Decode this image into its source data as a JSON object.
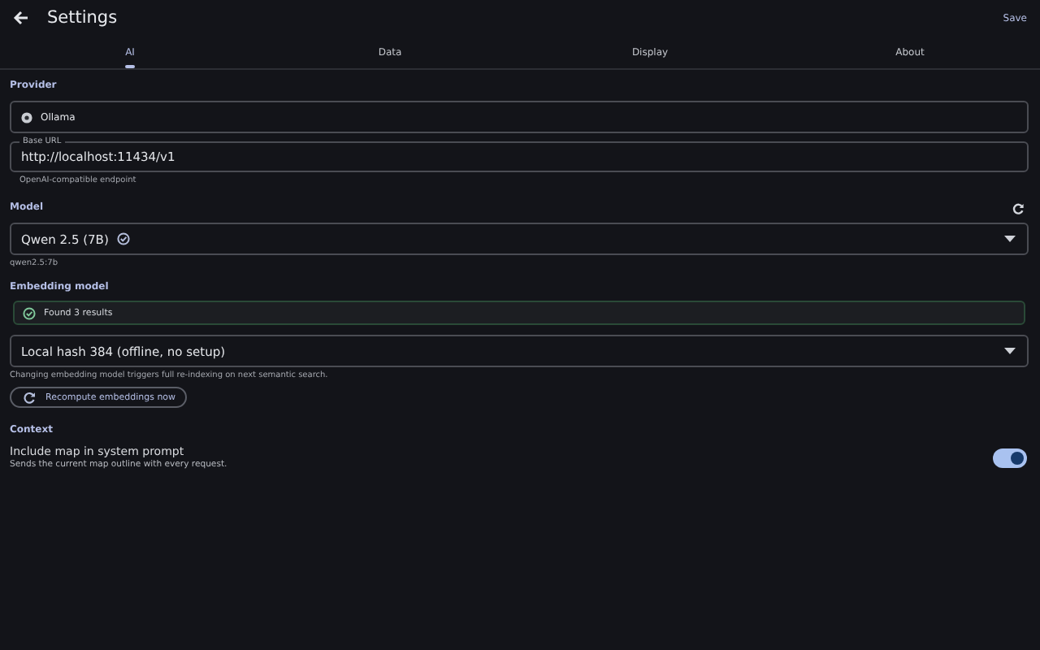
{
  "header": {
    "title": "Settings",
    "save": "Save"
  },
  "tabs": [
    {
      "label": "AI",
      "selected": true
    },
    {
      "label": "Data",
      "selected": false
    },
    {
      "label": "Display",
      "selected": false
    },
    {
      "label": "About",
      "selected": false
    }
  ],
  "provider": {
    "heading": "Provider",
    "value": "Ollama",
    "base_url": {
      "label": "Base URL",
      "value": "http://localhost:11434/v1",
      "helper": "OpenAI-compatible endpoint"
    }
  },
  "model": {
    "heading": "Model",
    "value": "Qwen 2.5 (7B)",
    "verified": true,
    "helper": "qwen2.5:7b"
  },
  "embedding": {
    "heading": "Embedding model",
    "status": "Found 3 results",
    "value": "Local hash 384 (offline, no setup)",
    "helper": "Changing embedding model triggers full re-indexing on next semantic search.",
    "button": "Recompute embeddings now"
  },
  "context": {
    "heading": "Context",
    "title": "Include map in system prompt",
    "subtitle": "Sends the current map outline with every request.",
    "on": true
  }
}
